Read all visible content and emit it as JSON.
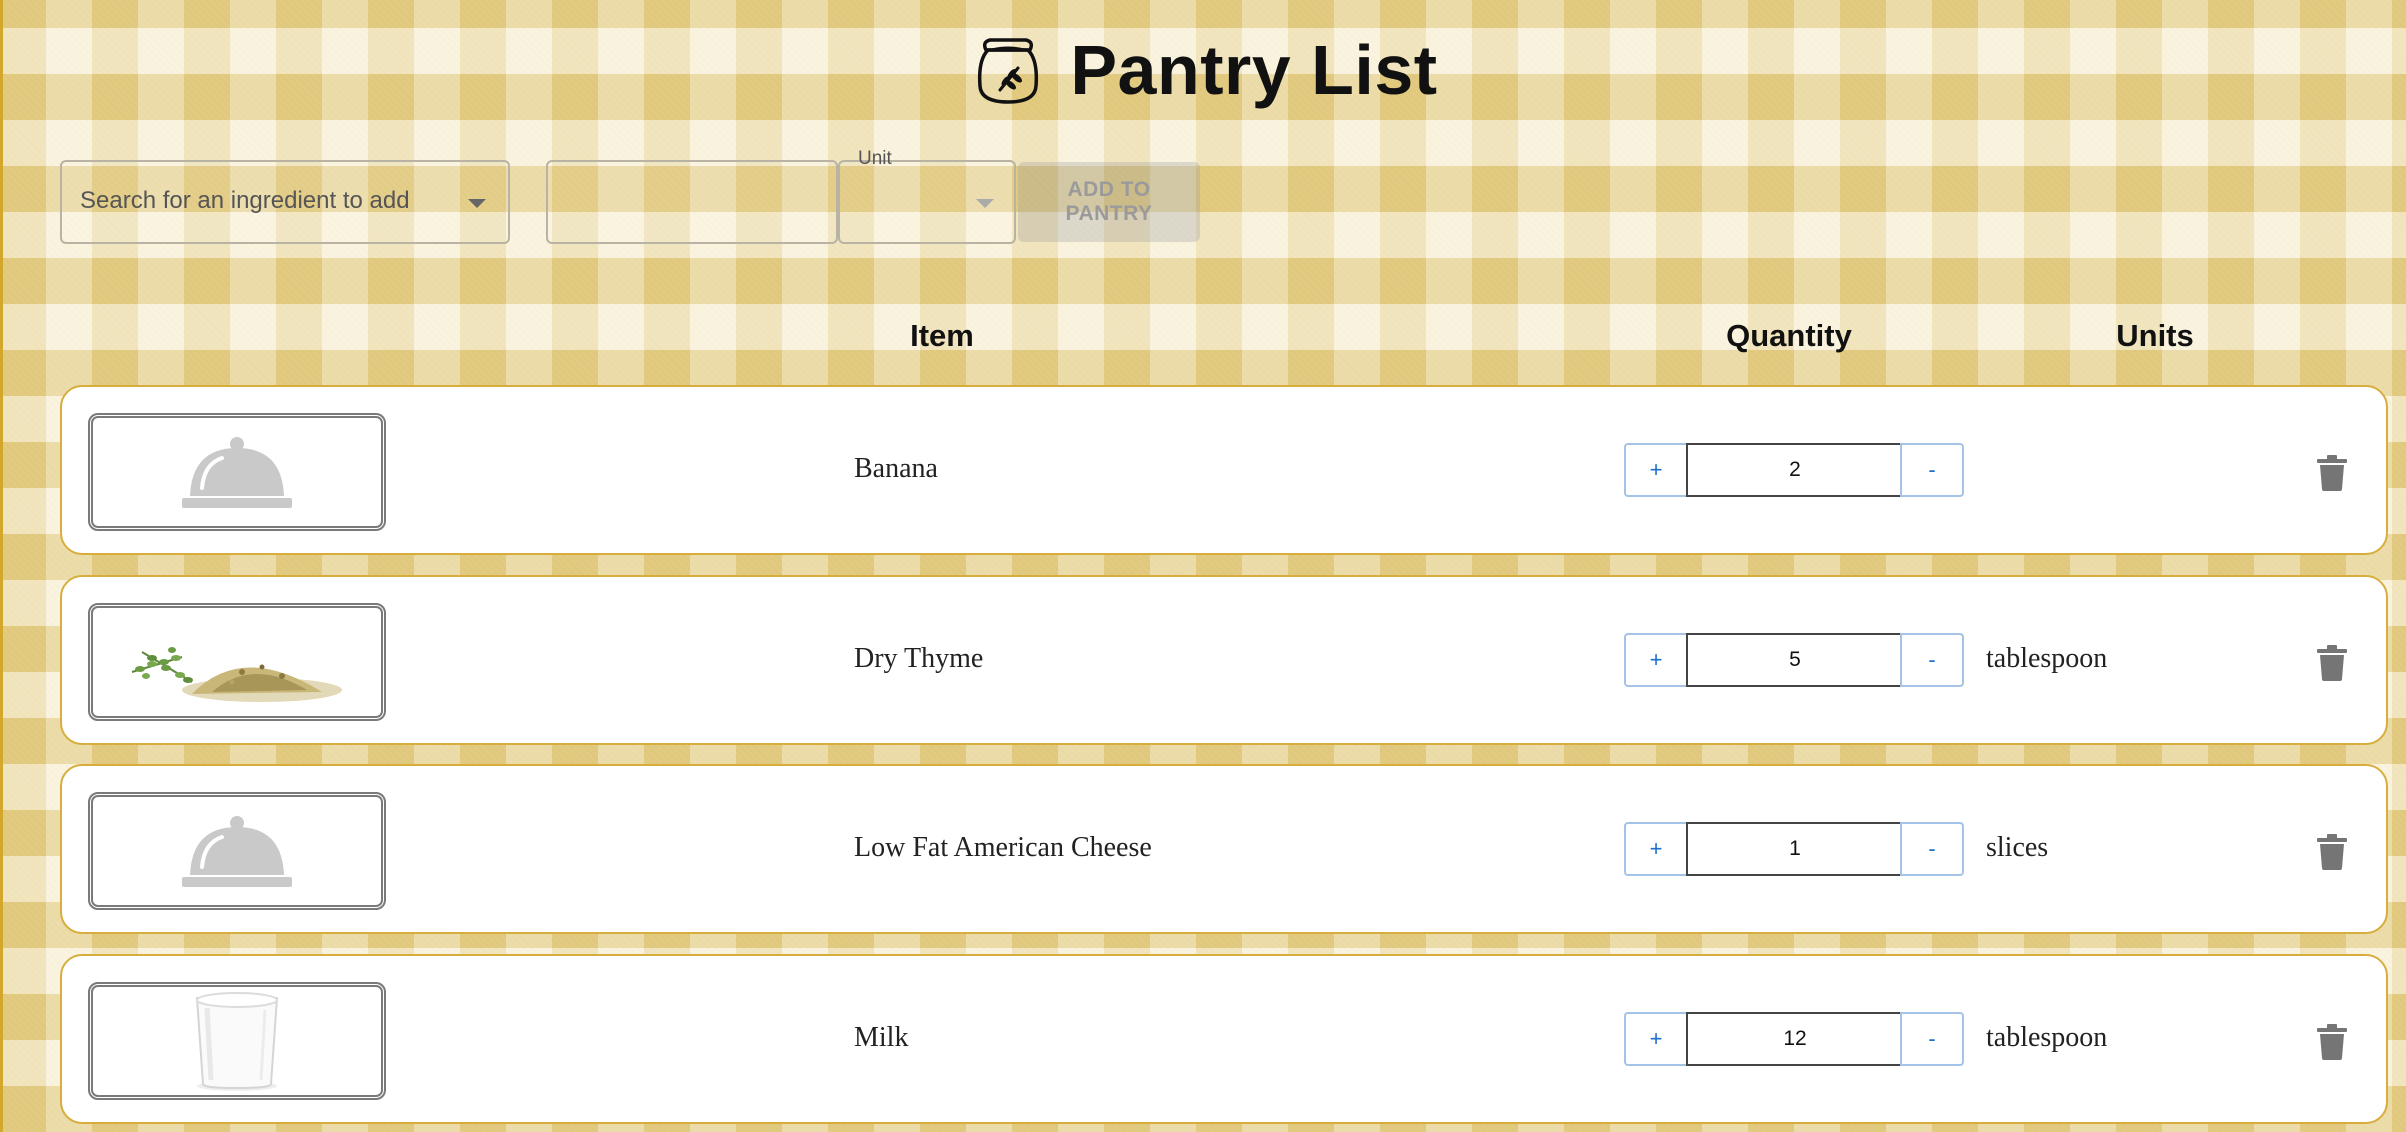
{
  "header": {
    "title": "Pantry List",
    "icon": "flour-sack-icon"
  },
  "toolbar": {
    "search_placeholder": "Search for an ingredient to add",
    "quantity_value": "",
    "unit_label": "Unit",
    "unit_value": "",
    "add_button_label": "ADD TO PANTRY",
    "add_button_disabled": true
  },
  "columns": {
    "item": "Item",
    "quantity": "Quantity",
    "units": "Units"
  },
  "rows": [
    {
      "name": "Banana",
      "quantity": "2",
      "unit": "",
      "image": "placeholder-cloche-icon",
      "plus": "+",
      "minus": "-"
    },
    {
      "name": "Dry Thyme",
      "quantity": "5",
      "unit": "tablespoon",
      "image": "thyme-photo",
      "plus": "+",
      "minus": "-"
    },
    {
      "name": "Low Fat American Cheese",
      "quantity": "1",
      "unit": "slices",
      "image": "placeholder-cloche-icon",
      "plus": "+",
      "minus": "-"
    },
    {
      "name": "Milk",
      "quantity": "12",
      "unit": "tablespoon",
      "image": "milk-glass-photo",
      "plus": "+",
      "minus": "-"
    }
  ],
  "colors": {
    "accent_border": "#d7ae3e",
    "stepper_blue": "#1d6fd0",
    "trash_gray": "#757575"
  }
}
